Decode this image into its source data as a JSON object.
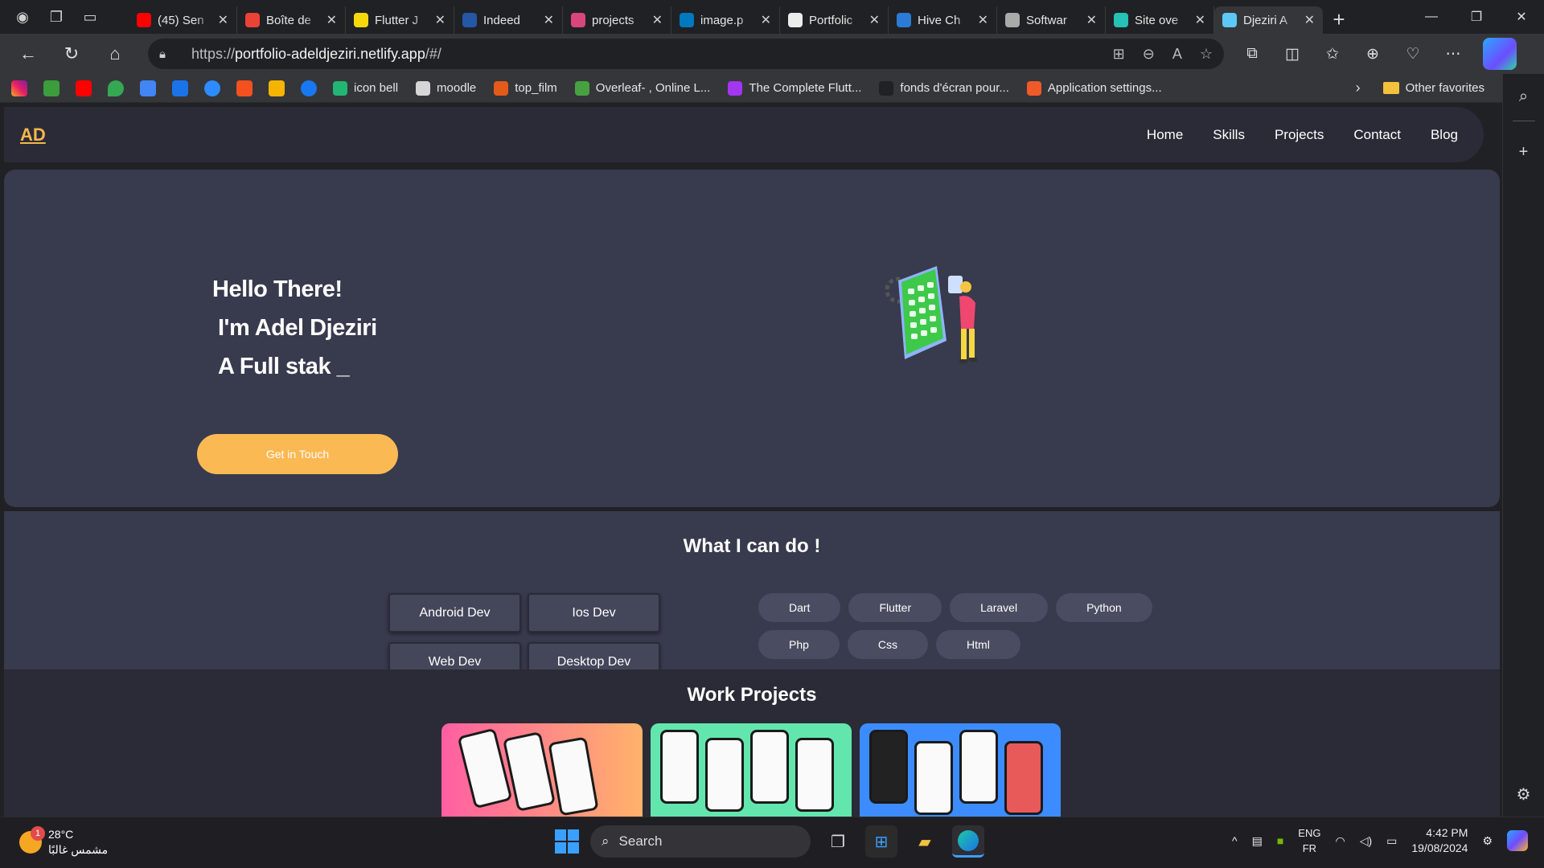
{
  "browser": {
    "tabs": [
      {
        "title": "(45) Sen",
        "icon": "youtube-icon",
        "color": "#ff0000"
      },
      {
        "title": "Boîte de",
        "icon": "gmail-icon",
        "color": "#ea4335"
      },
      {
        "title": "Flutter J",
        "icon": "flutter-jobs-icon",
        "color": "#f5d90a"
      },
      {
        "title": "Indeed",
        "icon": "indeed-icon",
        "color": "#2557a7"
      },
      {
        "title": "projects",
        "icon": "trello-icon",
        "color": "#d9467d"
      },
      {
        "title": "image.p",
        "icon": "trello-blue-icon",
        "color": "#0079bf"
      },
      {
        "title": "Portfolic",
        "icon": "chatgpt-icon",
        "color": "#ececec"
      },
      {
        "title": "Hive Ch",
        "icon": "hive-icon",
        "color": "#2b7cd6"
      },
      {
        "title": "Softwar",
        "icon": "software-icon",
        "color": "#aaaaaa"
      },
      {
        "title": "Site ove",
        "icon": "netlify-icon",
        "color": "#25c2b5"
      },
      {
        "title": "Djeziri A",
        "icon": "flutter-icon",
        "color": "#5dc8f5",
        "active": true
      }
    ],
    "url_prefix": "https://",
    "url_host": "portfolio-adeldjeziri.netlify.app",
    "url_path": "/#/",
    "bookmarks": [
      {
        "label": "icon bell",
        "color": "#22b573"
      },
      {
        "label": "moodle",
        "color": "#d6d6d6"
      },
      {
        "label": "top_film",
        "color": "#e35a1a"
      },
      {
        "label": "Overleaf- , Online L...",
        "color": "#47a141"
      },
      {
        "label": "The Complete Flutt...",
        "color": "#a435f0"
      },
      {
        "label": "fonds d'écran pour...",
        "color": "#202124"
      },
      {
        "label": "Application settings...",
        "color": "#f05a28"
      }
    ],
    "other_favorites": "Other favorites"
  },
  "site": {
    "logo": "AD",
    "nav": [
      "Home",
      "Skills",
      "Projects",
      "Contact",
      "Blog"
    ],
    "hero": {
      "line1": "Hello There!",
      "line2": "I'm Adel Djeziri",
      "line3": "A Full stak _",
      "cta": "Get in Touch"
    },
    "skills": {
      "title": "What I can do !",
      "roles": [
        "Android Dev",
        "Ios Dev",
        "Web Dev",
        "Desktop Dev"
      ],
      "tech_row1": [
        "Dart",
        "Flutter",
        "Laravel",
        "Python"
      ],
      "tech_row2": [
        "Php",
        "Css",
        "Html"
      ]
    },
    "projects": {
      "title": "Work Projects"
    },
    "accent": "#fbb954"
  },
  "taskbar": {
    "temp": "28°C",
    "weather": "مشمس غالبًا",
    "badge": "1",
    "search": "Search",
    "lang1": "ENG",
    "lang2": "FR",
    "time": "4:42 PM",
    "date": "19/08/2024"
  }
}
